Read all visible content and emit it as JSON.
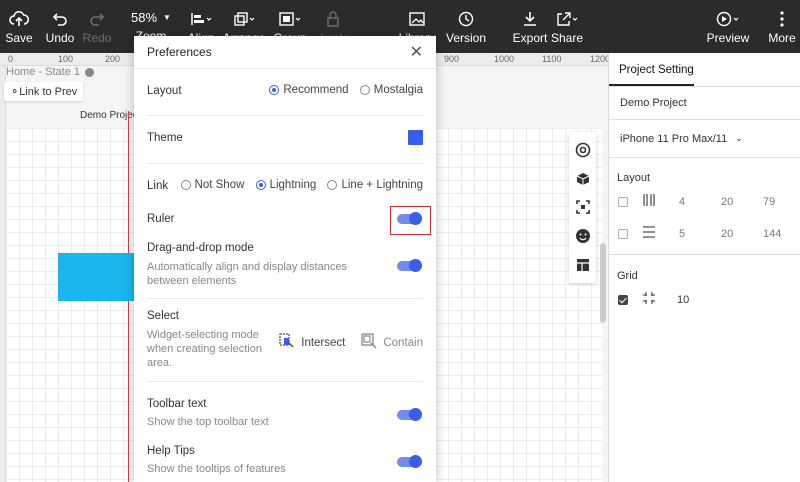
{
  "toolbar": {
    "save": "Save",
    "undo": "Undo",
    "redo": "Redo",
    "zoom_value": "58%",
    "zoom": "Zoom",
    "align": "Align",
    "arrange": "Arrange",
    "group": "Group",
    "lock": "Lock",
    "library": "Library",
    "version": "Version",
    "export": "Export",
    "share": "Share",
    "preview": "Preview",
    "more": "More"
  },
  "canvas": {
    "ruler_ticks": [
      "0",
      "100",
      "200",
      "900",
      "1000",
      "1100",
      "1200"
    ],
    "state_label": "Home - State 1",
    "link_prev": "Link to Prev",
    "artboard_label": "Demo Project"
  },
  "dialog": {
    "title": "Preferences",
    "layout": {
      "label": "Layout",
      "options": [
        "Recommend",
        "Mostalgia"
      ],
      "selected": "Recommend"
    },
    "theme": {
      "label": "Theme",
      "color": "#3b5de7"
    },
    "link": {
      "label": "Link",
      "options": [
        "Not Show",
        "Lightning",
        "Line + Lightning"
      ],
      "selected": "Lightning"
    },
    "ruler": {
      "label": "Ruler",
      "enabled": true
    },
    "drag_drop": {
      "label": "Drag-and-drop mode",
      "desc": "Automatically align and display distances between elements",
      "enabled": true
    },
    "select": {
      "label": "Select",
      "desc": "Widget-selecting mode when creating selection area.",
      "options": [
        "Intersect",
        "Contain"
      ],
      "selected": "Intersect"
    },
    "toolbar_text": {
      "label": "Toolbar text",
      "desc": "Show the top toolbar text",
      "enabled": true
    },
    "help_tips": {
      "label": "Help Tips",
      "desc": "Show the tooltips of features",
      "enabled": true
    }
  },
  "right_panel": {
    "tab": "Project Setting",
    "project_name": "Demo Project",
    "device": "iPhone 11 Pro Max/11",
    "layout_title": "Layout",
    "layout_rows": [
      {
        "values": [
          "4",
          "20",
          "79"
        ],
        "checked": false
      },
      {
        "values": [
          "5",
          "20",
          "144"
        ],
        "checked": false
      }
    ],
    "grid_title": "Grid",
    "grid_value": "10",
    "grid_checked": true
  },
  "colors": {
    "accent": "#3b5de7",
    "toolbar_bg": "#2b2b2b",
    "highlight_border": "#c53030",
    "shape_fill": "#1bb6ef"
  }
}
